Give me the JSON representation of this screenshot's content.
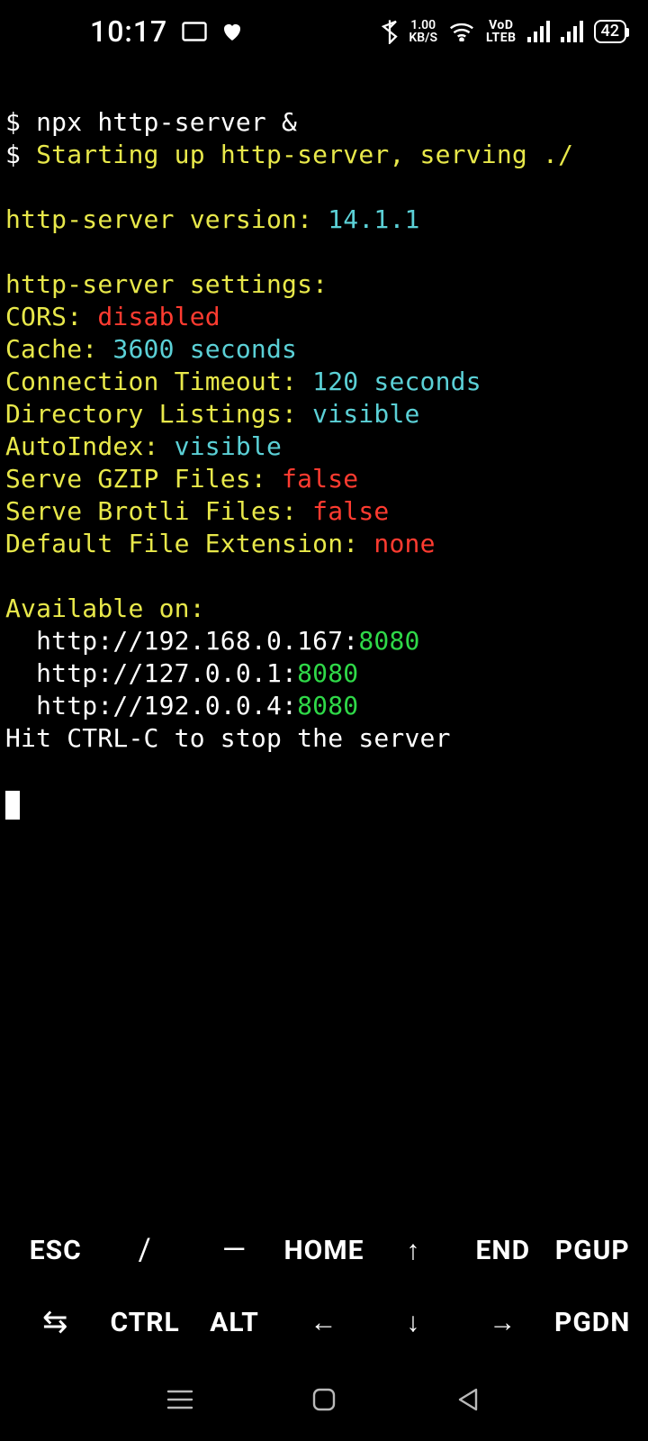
{
  "status": {
    "time": "10:17",
    "kbps_top": "1.00",
    "kbps_bot": "KB/S",
    "lte_top": "VoD",
    "lte_bot": "LTEB",
    "battery": "42"
  },
  "term": {
    "prompt": "$ ",
    "cmd": "npx http-server &",
    "start_msg": "Starting up http-server, serving ./",
    "version_label": "http-server version: ",
    "version_value": "14.1.1",
    "settings_header": "http-server settings: ",
    "cors_label": "CORS: ",
    "cors_value": "disabled",
    "cache_label": "Cache: ",
    "cache_value": "3600 seconds",
    "timeout_label": "Connection Timeout: ",
    "timeout_value": "120 seconds",
    "dirlist_label": "Directory Listings: ",
    "dirlist_value": "visible",
    "autoindex_label": "AutoIndex: ",
    "autoindex_value": "visible",
    "gzip_label": "Serve GZIP Files: ",
    "gzip_value": "false",
    "brotli_label": "Serve Brotli Files: ",
    "brotli_value": "false",
    "defext_label": "Default File Extension: ",
    "defext_value": "none",
    "avail_header": "Available on:",
    "url1_host": "  http://192.168.0.167:",
    "url1_port": "8080",
    "url2_host": "  http://127.0.0.1:",
    "url2_port": "8080",
    "url3_host": "  http://192.0.0.4:",
    "url3_port": "8080",
    "stop_msg": "Hit CTRL-C to stop the server"
  },
  "keys": {
    "esc": "ESC",
    "slash": "/",
    "dash": "—",
    "home": "HOME",
    "up": "↑",
    "end": "END",
    "pgup": "PGUP",
    "tab": "⇆",
    "ctrl": "CTRL",
    "alt": "ALT",
    "left": "←",
    "down": "↓",
    "right": "→",
    "pgdn": "PGDN"
  }
}
